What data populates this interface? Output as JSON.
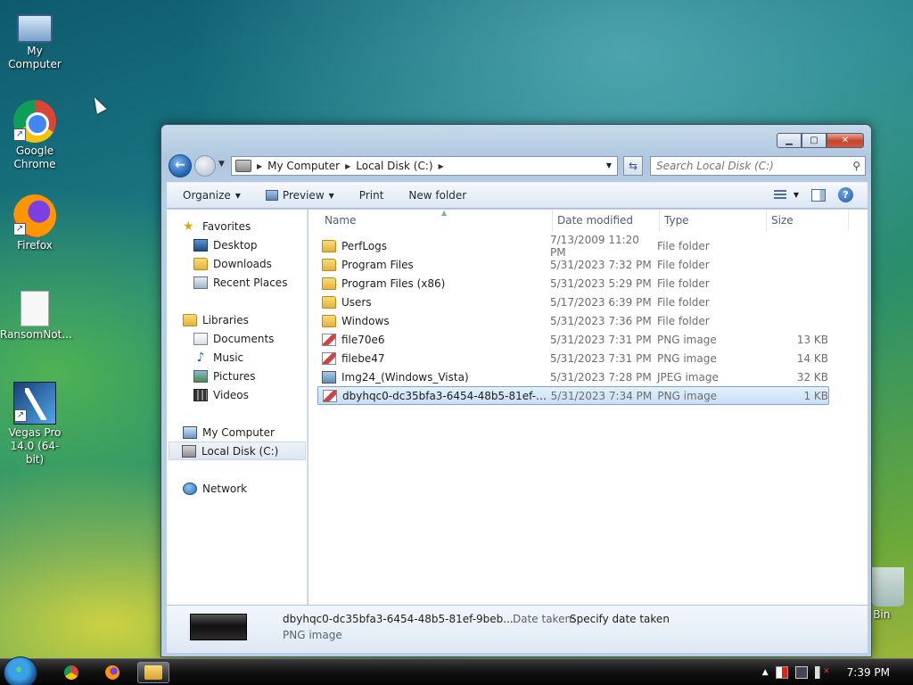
{
  "desktop": {
    "icons": [
      {
        "label": "My Computer",
        "icon": "computer-icon"
      },
      {
        "label": "Google Chrome",
        "icon": "chrome-icon"
      },
      {
        "label": "Firefox",
        "icon": "firefox-icon"
      },
      {
        "label": "RansomNot...",
        "icon": "text-file-icon"
      },
      {
        "label": "Vegas Pro 14.0 (64-bit)",
        "icon": "vegas-icon"
      },
      {
        "label": "e Bin",
        "icon": "recycle-bin-icon"
      }
    ]
  },
  "window": {
    "controls": {
      "minimize": "▁",
      "maximize": "▢",
      "close": "✕"
    },
    "address": {
      "segments": [
        "My Computer",
        "Local Disk (C:)"
      ]
    },
    "search": {
      "placeholder": "Search Local Disk (C:)"
    },
    "toolbar": {
      "organize": "Organize",
      "preview": "Preview",
      "print": "Print",
      "new_folder": "New folder"
    },
    "nav": {
      "favorites": "Favorites",
      "desktop": "Desktop",
      "downloads": "Downloads",
      "recent": "Recent Places",
      "libraries": "Libraries",
      "documents": "Documents",
      "music": "Music",
      "pictures": "Pictures",
      "videos": "Videos",
      "computer": "My Computer",
      "local_disk": "Local Disk (C:)",
      "network": "Network"
    },
    "columns": {
      "name": "Name",
      "date": "Date modified",
      "type": "Type",
      "size": "Size"
    },
    "files": [
      {
        "name": "PerfLogs",
        "date": "7/13/2009 11:20 PM",
        "type": "File folder",
        "size": "",
        "icon": "folder"
      },
      {
        "name": "Program Files",
        "date": "5/31/2023 7:32 PM",
        "type": "File folder",
        "size": "",
        "icon": "folder"
      },
      {
        "name": "Program Files (x86)",
        "date": "5/31/2023 5:29 PM",
        "type": "File folder",
        "size": "",
        "icon": "folder"
      },
      {
        "name": "Users",
        "date": "5/17/2023 6:39 PM",
        "type": "File folder",
        "size": "",
        "icon": "folder"
      },
      {
        "name": "Windows",
        "date": "5/31/2023 7:36 PM",
        "type": "File folder",
        "size": "",
        "icon": "folder"
      },
      {
        "name": "file70e6",
        "date": "5/31/2023 7:31 PM",
        "type": "PNG image",
        "size": "13 KB",
        "icon": "png"
      },
      {
        "name": "filebe47",
        "date": "5/31/2023 7:31 PM",
        "type": "PNG image",
        "size": "14 KB",
        "icon": "png"
      },
      {
        "name": "Img24_(Windows_Vista)",
        "date": "5/31/2023 7:28 PM",
        "type": "JPEG image",
        "size": "32 KB",
        "icon": "jpeg"
      },
      {
        "name": "dbyhqc0-dc35bfa3-6454-48b5-81ef-9beb...",
        "date": "5/31/2023 7:34 PM",
        "type": "PNG image",
        "size": "1 KB",
        "icon": "png",
        "selected": true
      }
    ],
    "details": {
      "name": "dbyhqc0-dc35bfa3-6454-48b5-81ef-9beb...",
      "type": "PNG image",
      "date_label": "Date taken:",
      "date_value": "Specify date taken"
    }
  },
  "taskbar": {
    "clock": "7:39 PM",
    "tray_arrow": "▲"
  }
}
